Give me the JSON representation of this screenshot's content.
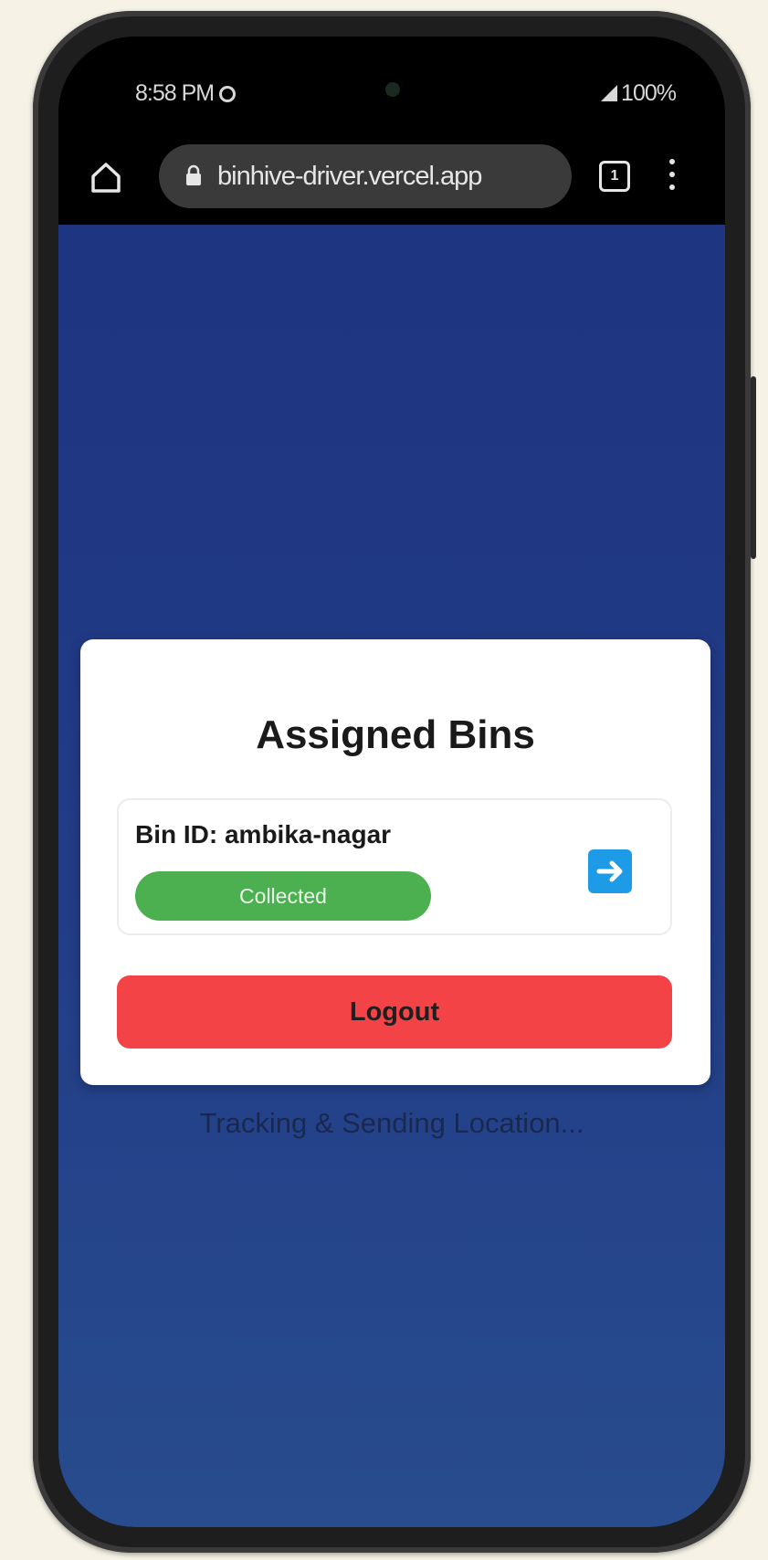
{
  "status_bar": {
    "time": "8:58 PM",
    "battery": "100%"
  },
  "browser": {
    "url": "binhive-driver.vercel.app",
    "tab_count": "1"
  },
  "card": {
    "title": "Assigned Bins",
    "bins": [
      {
        "id_label": "Bin ID: ambika-nagar",
        "status": "Collected",
        "status_color": "#4caf50"
      }
    ],
    "logout_label": "Logout"
  },
  "tracking_text": "Tracking & Sending Location...",
  "colors": {
    "background_top": "#1e3582",
    "background_bottom": "#284c8e",
    "logout": "#f44346",
    "action_button": "#1e9be6"
  },
  "icons": {
    "home": "home-icon",
    "lock": "lock-icon",
    "tabs": "tabs-icon",
    "menu": "more-vert-icon",
    "arrow": "arrow-right-icon"
  }
}
